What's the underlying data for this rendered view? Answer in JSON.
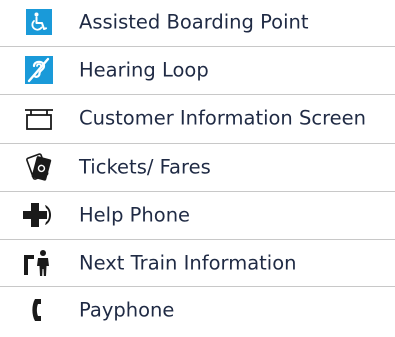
{
  "legend": {
    "items": [
      {
        "label": "Assisted Boarding Point",
        "icon": "wheelchair-icon"
      },
      {
        "label": "Hearing Loop",
        "icon": "hearing-loop-icon"
      },
      {
        "label": "Customer Information Screen",
        "icon": "information-screen-icon"
      },
      {
        "label": "Tickets/ Fares",
        "icon": "tickets-icon"
      },
      {
        "label": "Help Phone",
        "icon": "help-phone-icon"
      },
      {
        "label": "Next Train Information",
        "icon": "next-train-info-icon"
      },
      {
        "label": "Payphone",
        "icon": "payphone-icon"
      }
    ]
  },
  "colors": {
    "accent_blue": "#1a9ad9",
    "icon_dark": "#1a1a1a",
    "text": "#1f2a44",
    "separator": "#c8c8c8"
  }
}
